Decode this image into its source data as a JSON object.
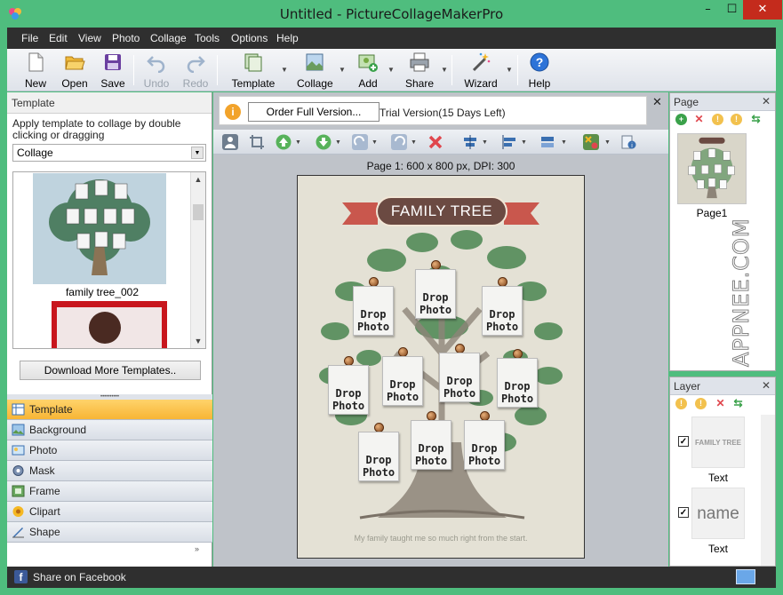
{
  "window": {
    "title": "Untitled - PictureCollageMakerPro"
  },
  "menu": [
    "File",
    "Edit",
    "View",
    "Photo",
    "Collage",
    "Tools",
    "Options",
    "Help"
  ],
  "toolbar": {
    "new": "New",
    "open": "Open",
    "save": "Save",
    "undo": "Undo",
    "redo": "Redo",
    "template": "Template",
    "collage": "Collage",
    "add": "Add",
    "share": "Share",
    "wizard": "Wizard",
    "help": "Help"
  },
  "left_panel": {
    "header": "Template",
    "hint": "Apply template to collage by double clicking or dragging",
    "category": "Collage",
    "templates": [
      {
        "label": "family tree_002"
      }
    ],
    "download_button": "Download More Templates..",
    "grip": "••••••••••",
    "tabs": [
      "Template",
      "Background",
      "Photo",
      "Mask",
      "Frame",
      "Clipart",
      "Shape"
    ],
    "more": "»"
  },
  "notice": {
    "icon": "i",
    "order_button": "Order Full Version...",
    "trial_text": "Trial Version(15 Days Left)",
    "close": "✕"
  },
  "canvas": {
    "page_info": "Page 1: 600 x 800 px, DPI: 300",
    "banner": "FAMILY TREE",
    "slot_text": "Drop\nPhoto",
    "caption": "My family taught me so much right from the start."
  },
  "page_panel": {
    "header": "Page",
    "close": "✕",
    "thumb_label": "Page1",
    "watermark": "APPNEE.COM"
  },
  "layer_panel": {
    "header": "Layer",
    "close": "✕",
    "items": [
      {
        "preview": "FAMILY TREE",
        "label": "Text",
        "checked": true
      },
      {
        "preview": "name",
        "label": "Text",
        "checked": true
      }
    ]
  },
  "status": {
    "facebook_icon": "f",
    "facebook_label": "Share on Facebook"
  },
  "colors": {
    "accent": "#4fbd7e",
    "menu_bg": "#2f2f2f",
    "active_tab": "#f7b535",
    "banner": "#6b4a42",
    "leaf": "#5a8f5e"
  }
}
